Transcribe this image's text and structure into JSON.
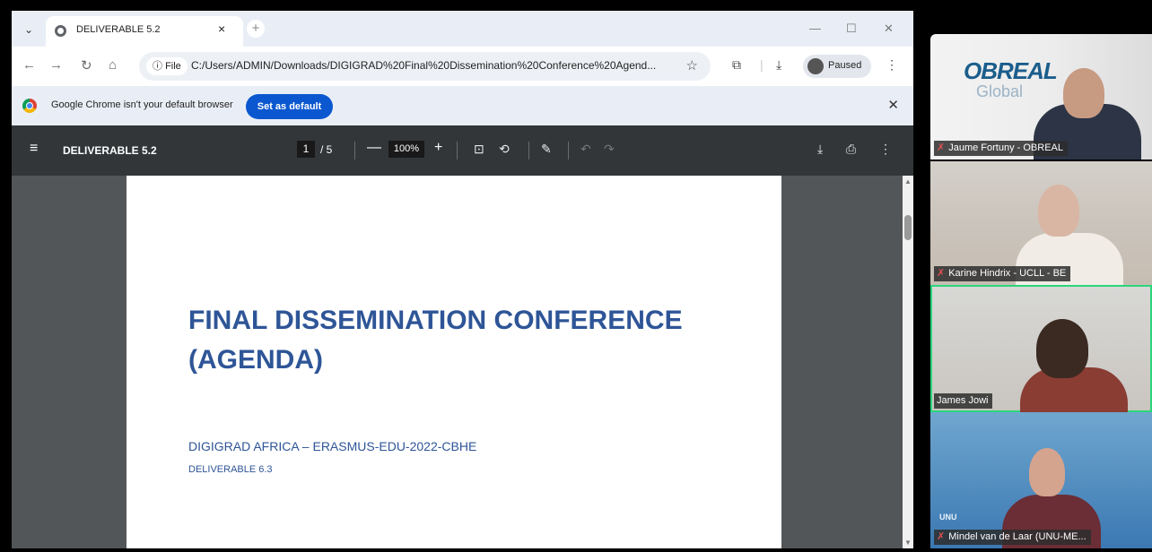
{
  "browser": {
    "tab": {
      "title": "DELIVERABLE 5.2",
      "close_glyph": "×",
      "new_tab_glyph": "+"
    },
    "window_controls": {
      "minimize": "—",
      "maximize": "☐",
      "close": "✕"
    },
    "address": {
      "scheme_chip": "File",
      "url": "C:/Users/ADMIN/Downloads/DIGIGRAD%20Final%20Dissemination%20Conference%20Agend...",
      "download_state": "Paused"
    },
    "banner": {
      "text": "Google Chrome isn't your default browser",
      "button": "Set as default"
    }
  },
  "pdf_viewer": {
    "title": "DELIVERABLE 5.2",
    "current_page": "1",
    "page_total": "/ 5",
    "zoom": "100%",
    "zoom_out": "—",
    "zoom_in": "+"
  },
  "document": {
    "title_line1": "FINAL DISSEMINATION CONFERENCE",
    "title_line2": "(AGENDA)",
    "subtitle": "DIGIGRAD AFRICA – ERASMUS-EDU-2022-CBHE",
    "deliverable": "DELIVERABLE 6.3"
  },
  "participants": [
    {
      "name": "Jaume Fortuny - OBREAL",
      "muted": true,
      "logo_line1": "OBREAL",
      "logo_line2": "Global"
    },
    {
      "name": "Karine Hindrix - UCLL - BE",
      "muted": true
    },
    {
      "name": "James Jowi",
      "muted": false,
      "active_speaker": true
    },
    {
      "name": "Mindel van de Laar (UNU-ME...",
      "muted": true,
      "backdrop_text": "UNU"
    }
  ],
  "colors": {
    "doc_heading": "#2e5597",
    "chrome_blue": "#0b57d0",
    "active_speaker": "#2bd67b",
    "pdf_toolbar": "#323639"
  }
}
